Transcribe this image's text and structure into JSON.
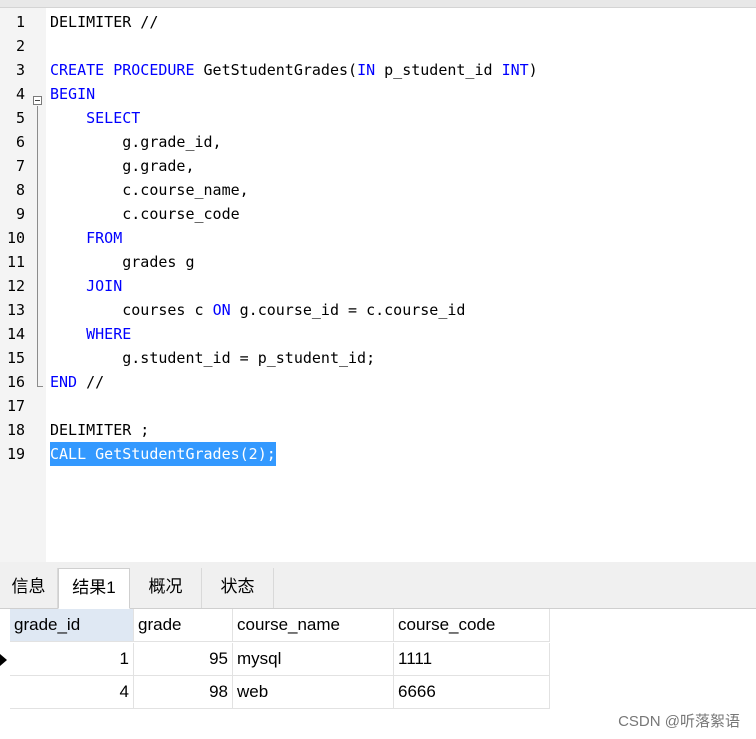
{
  "editor": {
    "lines": [
      {
        "n": "1",
        "parts": [
          {
            "t": "DELIMITER //"
          }
        ]
      },
      {
        "n": "2",
        "parts": []
      },
      {
        "n": "3",
        "parts": [
          {
            "t": "CREATE PROCEDURE",
            "k": true
          },
          {
            "t": " GetStudentGrades("
          },
          {
            "t": "IN",
            "k": true
          },
          {
            "t": " p_student_id "
          },
          {
            "t": "INT",
            "k": true
          },
          {
            "t": ")"
          }
        ]
      },
      {
        "n": "4",
        "parts": [
          {
            "t": "BEGIN",
            "k": true
          }
        ]
      },
      {
        "n": "5",
        "parts": [
          {
            "t": "    "
          },
          {
            "t": "SELECT",
            "k": true
          }
        ]
      },
      {
        "n": "6",
        "parts": [
          {
            "t": "        g.grade_id,"
          }
        ]
      },
      {
        "n": "7",
        "parts": [
          {
            "t": "        g.grade,"
          }
        ]
      },
      {
        "n": "8",
        "parts": [
          {
            "t": "        c.course_name,"
          }
        ]
      },
      {
        "n": "9",
        "parts": [
          {
            "t": "        c.course_code"
          }
        ]
      },
      {
        "n": "10",
        "parts": [
          {
            "t": "    "
          },
          {
            "t": "FROM",
            "k": true
          }
        ]
      },
      {
        "n": "11",
        "parts": [
          {
            "t": "        grades g"
          }
        ]
      },
      {
        "n": "12",
        "parts": [
          {
            "t": "    "
          },
          {
            "t": "JOIN",
            "k": true
          }
        ]
      },
      {
        "n": "13",
        "parts": [
          {
            "t": "        courses c "
          },
          {
            "t": "ON",
            "k": true
          },
          {
            "t": " g.course_id = c.course_id"
          }
        ]
      },
      {
        "n": "14",
        "parts": [
          {
            "t": "    "
          },
          {
            "t": "WHERE",
            "k": true
          }
        ]
      },
      {
        "n": "15",
        "parts": [
          {
            "t": "        g.student_id = p_student_id;"
          }
        ]
      },
      {
        "n": "16",
        "parts": [
          {
            "t": "END",
            "k": true
          },
          {
            "t": " //"
          }
        ]
      },
      {
        "n": "17",
        "parts": []
      },
      {
        "n": "18",
        "parts": [
          {
            "t": "DELIMITER ;"
          }
        ]
      },
      {
        "n": "19",
        "parts": [
          {
            "t": "CALL GetStudentGrades(2);"
          }
        ],
        "selected": true
      }
    ]
  },
  "tabs": [
    {
      "label": "信息",
      "active": false
    },
    {
      "label": "结果1",
      "active": true
    },
    {
      "label": "概况",
      "active": false
    },
    {
      "label": "状态",
      "active": false
    }
  ],
  "results": {
    "columns": [
      "grade_id",
      "grade",
      "course_name",
      "course_code"
    ],
    "rows": [
      {
        "grade_id": "1",
        "grade": "95",
        "course_name": "mysql",
        "course_code": "1111",
        "current": true
      },
      {
        "grade_id": "4",
        "grade": "98",
        "course_name": "web",
        "course_code": "6666",
        "current": false
      }
    ]
  },
  "watermark": "CSDN @听落絮语",
  "colors": {
    "keyword": "#0000ff",
    "selection": "#3399ff",
    "header_first": "#dfe8f3"
  }
}
